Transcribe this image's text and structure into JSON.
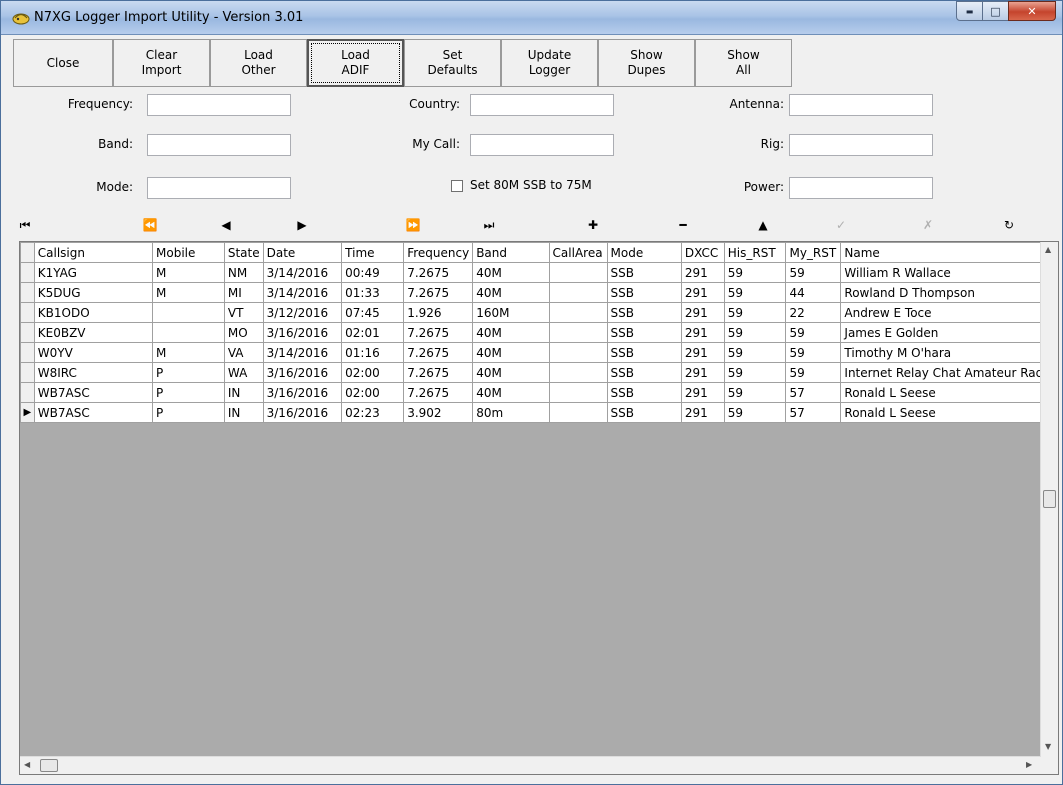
{
  "window": {
    "title": "N7XG Logger Import Utility - Version 3.01",
    "minimize_glyph": "▬",
    "maximize_glyph": "□",
    "close_glyph": "✕"
  },
  "toolbar": [
    {
      "name": "close-button",
      "label": "Close"
    },
    {
      "name": "clear-import-button",
      "label": "Clear\nImport"
    },
    {
      "name": "load-other-button",
      "label": "Load\nOther"
    },
    {
      "name": "load-adif-button",
      "label": "Load\nADIF"
    },
    {
      "name": "set-defaults-button",
      "label": "Set\nDefaults"
    },
    {
      "name": "update-logger-button",
      "label": "Update\nLogger"
    },
    {
      "name": "show-dupes-button",
      "label": "Show\nDupes"
    },
    {
      "name": "show-all-button",
      "label": "Show\nAll"
    }
  ],
  "form": {
    "frequency_label": "Frequency:",
    "frequency_value": "",
    "band_label": "Band:",
    "band_value": "",
    "mode_label": "Mode:",
    "mode_value": "",
    "country_label": "Country:",
    "country_value": "",
    "mycall_label": "My Call:",
    "mycall_value": "",
    "antenna_label": "Antenna:",
    "antenna_value": "",
    "rig_label": "Rig:",
    "rig_value": "",
    "power_label": "Power:",
    "power_value": "",
    "set80_label": "Set 80M SSB to 75M",
    "set80_checked": false
  },
  "navigator": [
    {
      "name": "first-record-icon",
      "glyph": "⏮",
      "enabled": true
    },
    {
      "name": "prior-page-icon",
      "glyph": "⏪",
      "enabled": true
    },
    {
      "name": "prior-record-icon",
      "glyph": "◀",
      "enabled": true
    },
    {
      "name": "next-record-icon",
      "glyph": "▶",
      "enabled": true
    },
    {
      "name": "next-page-icon",
      "glyph": "⏩",
      "enabled": true
    },
    {
      "name": "last-record-icon",
      "glyph": "⏭",
      "enabled": true
    },
    {
      "name": "insert-record-icon",
      "glyph": "✚",
      "enabled": true
    },
    {
      "name": "delete-record-icon",
      "glyph": "━",
      "enabled": true
    },
    {
      "name": "edit-record-icon",
      "glyph": "▲",
      "enabled": true
    },
    {
      "name": "post-edit-icon",
      "glyph": "✓",
      "enabled": false
    },
    {
      "name": "cancel-edit-icon",
      "glyph": "✗",
      "enabled": false
    },
    {
      "name": "refresh-icon",
      "glyph": "↻",
      "enabled": true
    }
  ],
  "grid": {
    "columns": [
      "Callsign",
      "Mobile",
      "State",
      "Date",
      "Time",
      "Frequency",
      "Band",
      "CallArea",
      "Mode",
      "DXCC",
      "His_RST",
      "My_RST",
      "Name"
    ],
    "rows": [
      [
        "K1YAG",
        "M",
        "NM",
        "3/14/2016",
        "00:49",
        "7.2675",
        "40M",
        "",
        "SSB",
        "291",
        "59",
        "59",
        "William R Wallace"
      ],
      [
        "K5DUG",
        "M",
        "MI",
        "3/14/2016",
        "01:33",
        "7.2675",
        "40M",
        "",
        "SSB",
        "291",
        "59",
        "44",
        "Rowland D Thompson"
      ],
      [
        "KB1ODO",
        "",
        "VT",
        "3/12/2016",
        "07:45",
        "1.926",
        "160M",
        "",
        "SSB",
        "291",
        "59",
        "22",
        "Andrew E Toce"
      ],
      [
        "KE0BZV",
        "",
        "MO",
        "3/16/2016",
        "02:01",
        "7.2675",
        "40M",
        "",
        "SSB",
        "291",
        "59",
        "59",
        "James E Golden"
      ],
      [
        "W0YV",
        "M",
        "VA",
        "3/14/2016",
        "01:16",
        "7.2675",
        "40M",
        "",
        "SSB",
        "291",
        "59",
        "59",
        "Timothy M O'hara"
      ],
      [
        "W8IRC",
        "P",
        "WA",
        "3/16/2016",
        "02:00",
        "7.2675",
        "40M",
        "",
        "SSB",
        "291",
        "59",
        "59",
        "Internet Relay Chat Amateur Radio"
      ],
      [
        "WB7ASC",
        "P",
        "IN",
        "3/16/2016",
        "02:00",
        "7.2675",
        "40M",
        "",
        "SSB",
        "291",
        "59",
        "57",
        "Ronald L Seese"
      ],
      [
        "WB7ASC",
        "P",
        "IN",
        "3/16/2016",
        "02:23",
        "3.902",
        "80m",
        "",
        "SSB",
        "291",
        "59",
        "57",
        "Ronald L Seese"
      ]
    ],
    "current_row": 7,
    "row_pointer_glyph": "▶"
  }
}
